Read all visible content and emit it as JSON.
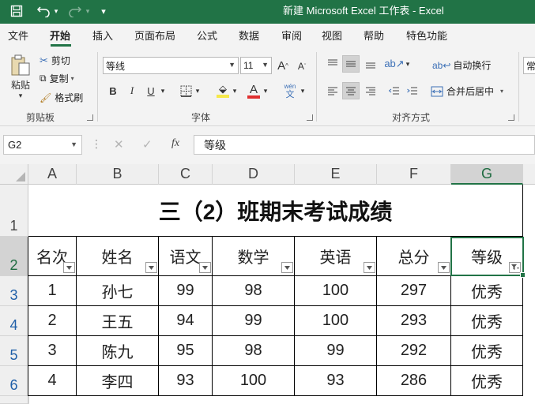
{
  "quick_access": {
    "save_icon": "save-icon",
    "undo_icon": "undo-icon",
    "redo_icon": "redo-icon",
    "customize_icon": "customize-icon"
  },
  "window": {
    "title": "新建 Microsoft Excel 工作表  -  Excel"
  },
  "menu": {
    "tabs": [
      "文件",
      "开始",
      "插入",
      "页面布局",
      "公式",
      "数据",
      "审阅",
      "视图",
      "帮助",
      "特色功能"
    ],
    "active": "开始"
  },
  "ribbon": {
    "clipboard": {
      "paste": "粘贴",
      "cut": "剪切",
      "copy": "复制",
      "format_painter": "格式刷",
      "group_label": "剪贴板"
    },
    "font": {
      "font_name": "等线",
      "font_size": "11",
      "bold": "B",
      "italic": "I",
      "underline": "U",
      "grow": "A",
      "shrink": "A",
      "phonetic_top": "wén",
      "phonetic_bottom": "文",
      "font_color_letter": "A",
      "group_label": "字体"
    },
    "alignment": {
      "wrap_text": "自动换行",
      "merge_center": "合并后居中",
      "group_label": "对齐方式"
    },
    "number": {
      "format_partial": "常"
    },
    "colors": {
      "accent": "#217346",
      "font_color": "#e03030",
      "fill_color": "#f5e84a"
    }
  },
  "formula_bar": {
    "name_box": "G2",
    "cancel": "✕",
    "enter": "✓",
    "fx": "fx",
    "content": "等级"
  },
  "sheet": {
    "columns": [
      "A",
      "B",
      "C",
      "D",
      "E",
      "F",
      "G"
    ],
    "selected_column": "G",
    "rows": [
      "1",
      "2",
      "3",
      "4",
      "5",
      "6"
    ],
    "selected_row": "2",
    "title": "三（2）班期末考试成绩",
    "headers": [
      "名次",
      "姓名",
      "语文",
      "数学",
      "英语",
      "总分",
      "等级"
    ],
    "data": [
      [
        "1",
        "孙七",
        "99",
        "98",
        "100",
        "297",
        "优秀"
      ],
      [
        "2",
        "王五",
        "94",
        "99",
        "100",
        "293",
        "优秀"
      ],
      [
        "3",
        "陈九",
        "95",
        "98",
        "99",
        "292",
        "优秀"
      ],
      [
        "4",
        "李四",
        "93",
        "100",
        "93",
        "286",
        "优秀"
      ]
    ]
  }
}
